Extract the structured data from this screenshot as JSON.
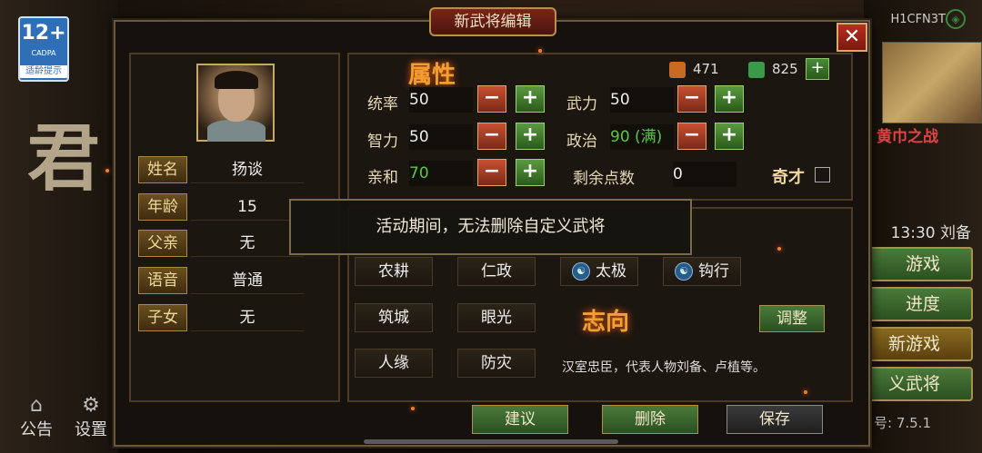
{
  "age_rating": {
    "number": "12+",
    "org": "CADPA",
    "tip": "适龄提示"
  },
  "background": {
    "big_char": "君",
    "left_buttons": [
      {
        "label": "公告",
        "icon": "home-icon"
      },
      {
        "label": "设置",
        "icon": "gear-icon"
      }
    ],
    "top_right_code": "H1CFN3T",
    "banner_label": "黄巾之战",
    "time_text": "13:30 刘备",
    "right_buttons": [
      "游戏",
      "进度",
      "新游戏",
      "义武将"
    ],
    "version": "号: 7.5.1"
  },
  "dialog": {
    "title": "新武将编辑",
    "close_label": "✕"
  },
  "profile": {
    "fields": [
      {
        "label": "姓名",
        "value": "扬谈"
      },
      {
        "label": "年龄",
        "value": "15"
      },
      {
        "label": "父亲",
        "value": "无"
      },
      {
        "label": "语音",
        "value": "普通"
      },
      {
        "label": "子女",
        "value": "无"
      }
    ]
  },
  "attributes": {
    "title": "属性",
    "resources": {
      "book": "471",
      "gem": "825"
    },
    "stats": {
      "tongshuai": {
        "label": "统率",
        "value": "50"
      },
      "wuli": {
        "label": "武力",
        "value": "50"
      },
      "zhili": {
        "label": "智力",
        "value": "50"
      },
      "zhengzhi": {
        "label": "政治",
        "value": "90 (满)"
      },
      "qinhe": {
        "label": "亲和",
        "value": "70"
      },
      "remaining": {
        "label": "剩余点数",
        "value": "0"
      }
    },
    "qicai_label": "奇才",
    "minus": "−",
    "plus": "+"
  },
  "skills": {
    "items": [
      "农耕",
      "仁政",
      "太极",
      "钩行",
      "筑城",
      "眼光",
      "人缘",
      "防灾"
    ],
    "special_icon": "☯",
    "aspiration_title": "志向",
    "adjust_label": "调整",
    "description": "汉室忠臣，代表人物刘备、卢植等。"
  },
  "actions": {
    "suggest": "建议",
    "delete": "删除",
    "save": "保存"
  },
  "toast": {
    "message": "活动期间，无法删除自定义武将"
  },
  "colors": {
    "accent_orange": "#f0a030",
    "green_value": "#5ac840",
    "panel_border": "#6a5838"
  }
}
